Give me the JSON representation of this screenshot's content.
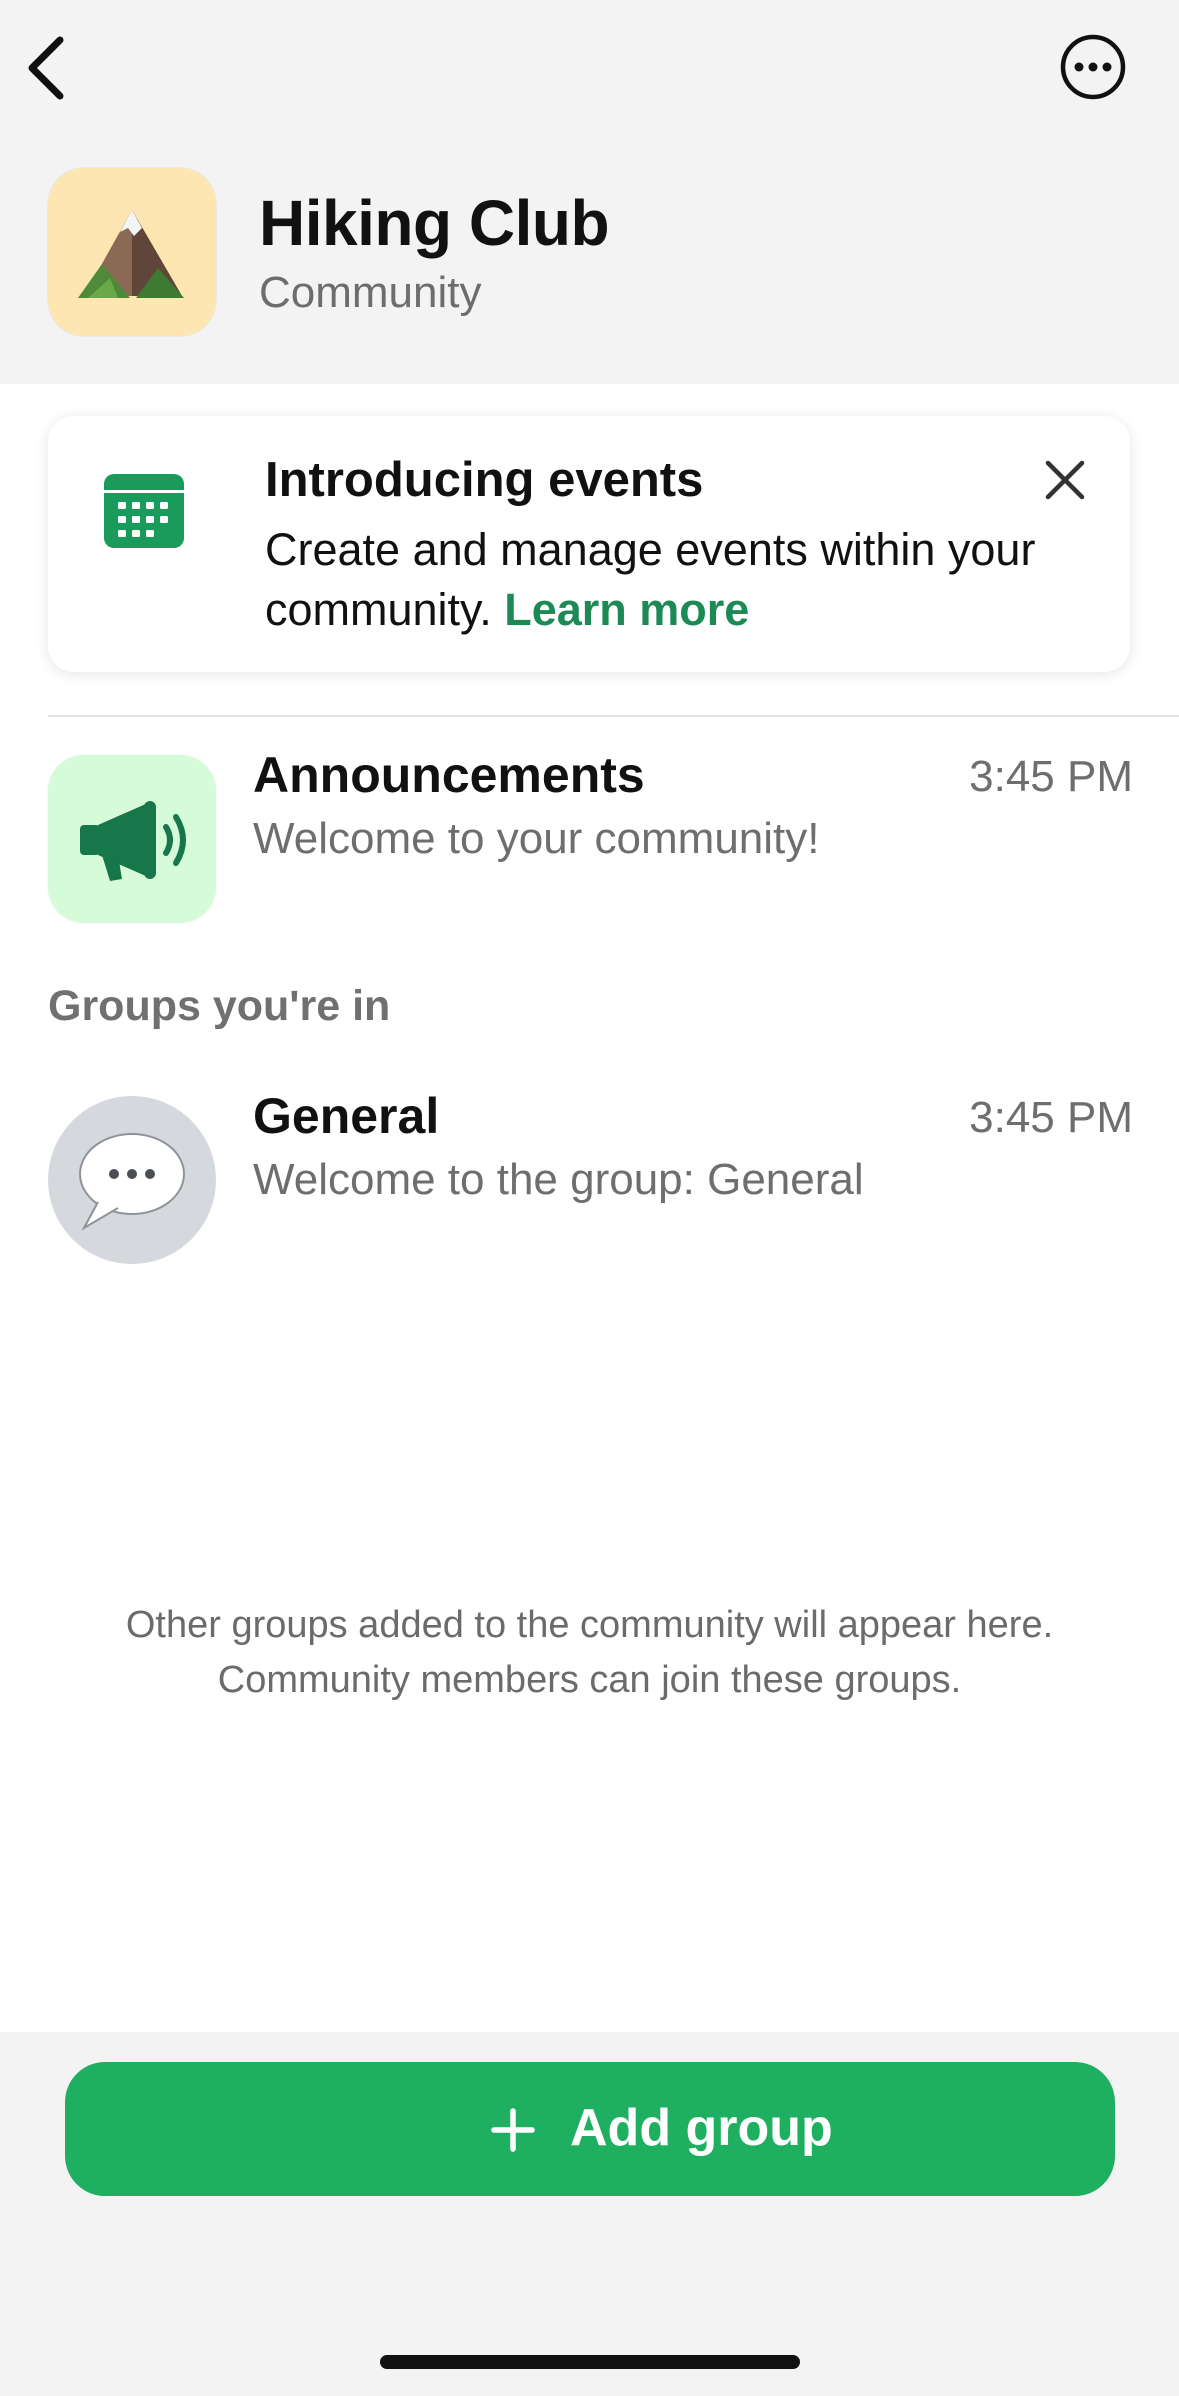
{
  "header": {
    "back_icon": "chevron-left-icon",
    "more_icon": "ellipsis-circle-icon",
    "community_name": "Hiking Club",
    "community_type": "Community",
    "avatar_icon": "mountain-emoji"
  },
  "banner": {
    "icon": "calendar-icon",
    "title": "Introducing events",
    "text": "Create and manage events within your community.",
    "link_text": "Learn more",
    "close_icon": "close-icon",
    "accent_color": "#1d8a55"
  },
  "announcements": {
    "icon": "megaphone-icon",
    "title": "Announcements",
    "subtitle": "Welcome to your community!",
    "time": "3:45 PM"
  },
  "groups_section": {
    "header": "Groups you're in",
    "items": [
      {
        "icon": "speech-bubble-icon",
        "title": "General",
        "subtitle": "Welcome to the group: General",
        "time": "3:45 PM"
      }
    ]
  },
  "footer_note": {
    "line1": "Other groups added to the community will appear here.",
    "line2": "Community members can join these groups."
  },
  "add_group_button": {
    "label": "Add group",
    "icon": "plus-icon",
    "color": "#1faf60"
  }
}
